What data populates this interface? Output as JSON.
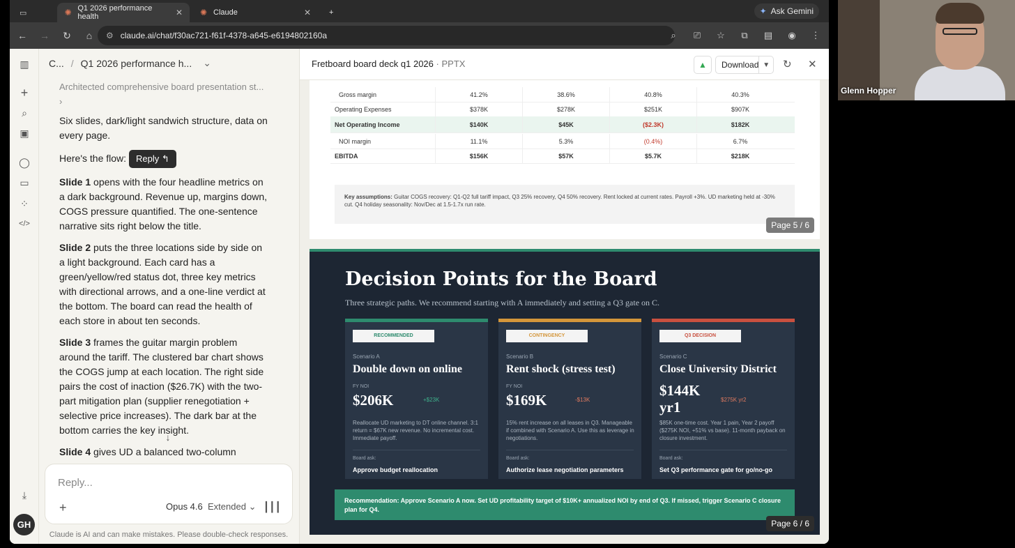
{
  "browser": {
    "tabs": [
      {
        "label": "Q1 2026 performance health"
      },
      {
        "label": "Claude"
      }
    ],
    "ask_gemini": "Ask Gemini",
    "url": "claude.ai/chat/f30ac721-f61f-4378-a645-e6194802160a"
  },
  "sidebar": {
    "breadcrumb_root": "C...",
    "breadcrumb_sep": "/",
    "chat_title": "Q1 2026 performance h...",
    "avatar_initials": "GH"
  },
  "chat": {
    "thinking_summary": "Architected comprehensive board presentation st...",
    "para1": "Six slides, dark/light sandwich structure, data on every page.",
    "para2": "Here's the flow:",
    "reply_tooltip": "Reply",
    "slide1_lead": "Slide 1",
    "slide1_text": " opens with the four headline metrics on a dark background. Revenue up, margins down, COGS pressure quantified. The one-sentence narrative sits right below the title.",
    "slide2_lead": "Slide 2",
    "slide2_text": " puts the three locations side by side on a light background. Each card has a green/yellow/red status dot, three key metrics with directional arrows, and a one-line verdict at the bottom. The board can read the health of each store in about ten seconds.",
    "slide3_lead": "Slide 3",
    "slide3_text": " frames the guitar margin problem around the tariff. The clustered bar chart shows the COGS jump at each location. The right side pairs the cost of inaction ($26.7K) with the two-part mitigation plan (supplier renegotiation + selective price increases). The dark bar at the bottom carries the key insight.",
    "slide4_lead": "Slide 4",
    "slide4_text": " gives UD a balanced two-column",
    "composer_placeholder": "Reply...",
    "model_name": "Opus 4.6",
    "model_mode": "Extended",
    "disclaimer": "Claude is AI and can make mistakes. Please double-check responses."
  },
  "artifact": {
    "title": "Fretboard board deck q1 2026",
    "kind": "· PPTX",
    "download_label": "Download",
    "slide5": {
      "rows": [
        {
          "label": "Gross margin",
          "values": [
            "41.2%",
            "38.6%",
            "40.8%",
            "40.3%"
          ]
        },
        {
          "label": "Operating Expenses",
          "values": [
            "$378K",
            "$278K",
            "$251K",
            "$907K"
          ]
        },
        {
          "label": "Net Operating Income",
          "values": [
            "$140K",
            "$45K",
            "($2.3K)",
            "$182K"
          ]
        },
        {
          "label": "NOI margin",
          "values": [
            "11.1%",
            "5.3%",
            "(0.4%)",
            "6.7%"
          ]
        },
        {
          "label": "EBITDA",
          "values": [
            "$156K",
            "$57K",
            "$5.7K",
            "$218K"
          ]
        }
      ],
      "assumptions_label": "Key assumptions:",
      "assumptions_text": "Guitar COGS recovery: Q1-Q2 full tariff impact, Q3 25% recovery, Q4 50% recovery. Rent locked at current rates. Payroll +3%. UD marketing held at -30% cut. Q4 holiday seasonality: Nov/Dec at 1.5-1.7x run rate.",
      "page": "Page 5 / 6"
    },
    "slide6": {
      "title": "Decision Points for the Board",
      "subtitle": "Three strategic paths. We recommend starting with A immediately and setting a Q3 gate on C.",
      "cards": [
        {
          "badge": "RECOMMENDED",
          "scenario": "Scenario A",
          "name": "Double down on online",
          "noi_label": "FY NOI",
          "noi": "$206K",
          "delta": "+$23K",
          "desc": "Reallocate UD marketing to DT online channel. 3:1 return = $67K new revenue. No incremental cost. Immediate payoff.",
          "ask_label": "Board ask:",
          "ask": "Approve budget reallocation",
          "accent": "#2e8b6e"
        },
        {
          "badge": "CONTINGENCY",
          "scenario": "Scenario B",
          "name": "Rent shock (stress test)",
          "noi_label": "FY NOI",
          "noi": "$169K",
          "delta": "-$13K",
          "desc": "15% rent increase on all leases in Q3. Manageable if combined with Scenario A. Use this as leverage in negotiations.",
          "ask_label": "Board ask:",
          "ask": "Authorize lease negotiation parameters",
          "accent": "#d4963a"
        },
        {
          "badge": "Q3 DECISION",
          "scenario": "Scenario C",
          "name": "Close University District",
          "noi_label": "",
          "noi": "$144K yr1",
          "delta": "$275K yr2",
          "desc": "$85K one-time cost. Year 1 pain, Year 2 payoff ($275K NOI, +51% vs base). 11-month payback on closure investment.",
          "ask_label": "Board ask:",
          "ask": "Set Q3 performance gate for go/no-go",
          "accent": "#c9503f"
        }
      ],
      "recommendation": "Recommendation: Approve Scenario A now. Set UD profitability target of $10K+ annualized NOI by end of Q3. If missed, trigger Scenario C closure plan for Q4.",
      "page": "Page 6 / 6"
    }
  },
  "video": {
    "participant": "Glenn Hopper"
  },
  "colors": {
    "green": "#2e8b6e",
    "amber": "#d4963a",
    "red": "#c9503f",
    "slide_bg": "#1d2633"
  }
}
